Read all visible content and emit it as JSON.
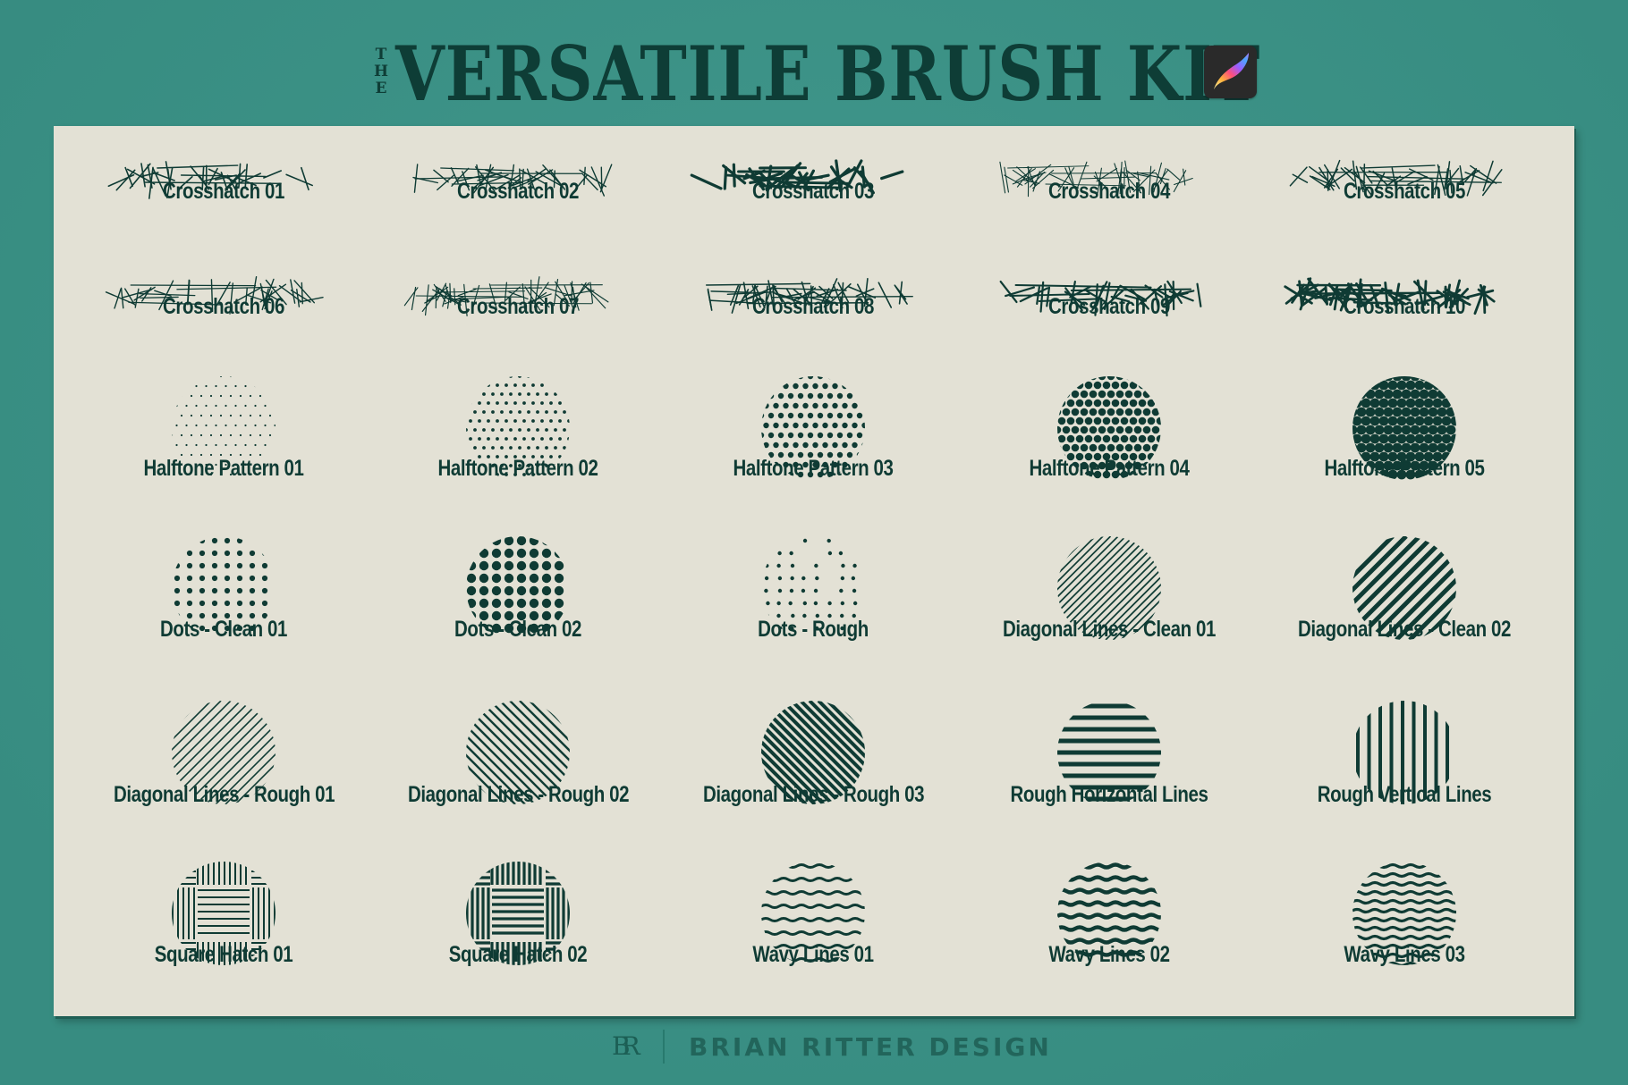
{
  "header": {
    "title_prefix": [
      "T",
      "H",
      "E"
    ],
    "title": "VERSATILE BRUSH KIT",
    "app_icon": "procreate-app-icon"
  },
  "colors": {
    "background": "#3a9488",
    "card": "#e3e1d5",
    "ink": "#0f3b34"
  },
  "brushes": [
    {
      "label": "Crosshatch 01",
      "type": "crosshatch",
      "variant": 1
    },
    {
      "label": "Crosshatch 02",
      "type": "crosshatch",
      "variant": 2
    },
    {
      "label": "Crosshatch 03",
      "type": "crosshatch",
      "variant": 3
    },
    {
      "label": "Crosshatch 04",
      "type": "crosshatch",
      "variant": 4
    },
    {
      "label": "Crosshatch 05",
      "type": "crosshatch",
      "variant": 5
    },
    {
      "label": "Crosshatch 06",
      "type": "crosshatch",
      "variant": 6
    },
    {
      "label": "Crosshatch 07",
      "type": "crosshatch",
      "variant": 7
    },
    {
      "label": "Crosshatch 08",
      "type": "crosshatch",
      "variant": 8
    },
    {
      "label": "Crosshatch 09",
      "type": "crosshatch",
      "variant": 9
    },
    {
      "label": "Crosshatch 10",
      "type": "crosshatch",
      "variant": 10
    },
    {
      "label": "Halftone Pattern 01",
      "type": "halftone",
      "variant": 1
    },
    {
      "label": "Halftone Pattern 02",
      "type": "halftone",
      "variant": 2
    },
    {
      "label": "Halftone Pattern 03",
      "type": "halftone",
      "variant": 3
    },
    {
      "label": "Halftone Pattern 04",
      "type": "halftone",
      "variant": 4
    },
    {
      "label": "Halftone Pattern 05",
      "type": "halftone",
      "variant": 5
    },
    {
      "label": "Dots - Clean 01",
      "type": "dots",
      "variant": 1
    },
    {
      "label": "Dots - Clean 02",
      "type": "dots",
      "variant": 2
    },
    {
      "label": "Dots - Rough",
      "type": "dots-rough",
      "variant": 1
    },
    {
      "label": "Diagonal Lines - Clean 01",
      "type": "diag",
      "variant": 1
    },
    {
      "label": "Diagonal Lines - Clean 02",
      "type": "diag",
      "variant": 2
    },
    {
      "label": "Diagonal Lines - Rough 01",
      "type": "diag-rough",
      "variant": 1
    },
    {
      "label": "Diagonal Lines - Rough 02",
      "type": "diag-rough",
      "variant": 2
    },
    {
      "label": "Diagonal Lines - Rough 03",
      "type": "diag-rough",
      "variant": 3
    },
    {
      "label": "Rough Horizontal Lines",
      "type": "hlines",
      "variant": 1
    },
    {
      "label": "Rough Vertical Lines",
      "type": "vlines",
      "variant": 1
    },
    {
      "label": "Square Hatch 01",
      "type": "square",
      "variant": 1
    },
    {
      "label": "Square Hatch 02",
      "type": "square",
      "variant": 2
    },
    {
      "label": "Wavy Lines 01",
      "type": "wavy",
      "variant": 1
    },
    {
      "label": "Wavy Lines 02",
      "type": "wavy",
      "variant": 2
    },
    {
      "label": "Wavy Lines 03",
      "type": "wavy",
      "variant": 3
    }
  ],
  "footer": {
    "monogram": "BR",
    "brand": "BRIAN RITTER DESIGN"
  }
}
